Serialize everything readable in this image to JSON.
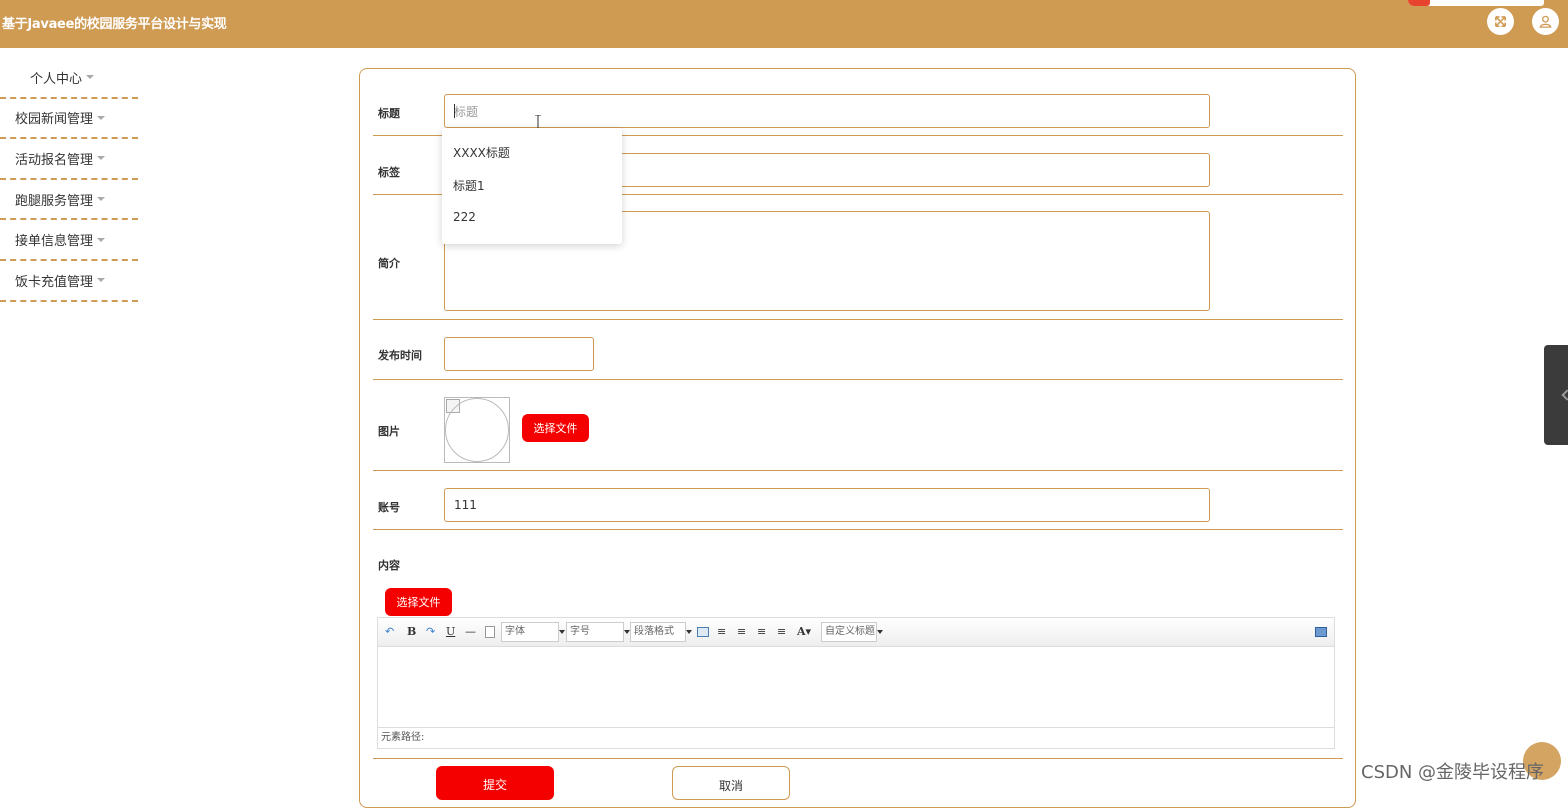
{
  "header": {
    "title": "基于Javaee的校园服务平台设计与实现",
    "accent_color": "#cf9a52",
    "icons": [
      "fullscreen-icon",
      "user-icon"
    ]
  },
  "sidebar": {
    "items": [
      {
        "label": "个人中心"
      },
      {
        "label": "校园新闻管理"
      },
      {
        "label": "活动报名管理"
      },
      {
        "label": "跑腿服务管理"
      },
      {
        "label": "接单信息管理"
      },
      {
        "label": "饭卡充值管理"
      }
    ]
  },
  "form": {
    "title_label": "标题",
    "title_placeholder": "标题",
    "title_suggestions": [
      "XXXX标题",
      "标题1",
      "222"
    ],
    "tag_label": "标签",
    "tag_value": "",
    "intro_label": "简介",
    "intro_value": "",
    "publish_time_label": "发布时间",
    "publish_time_value": "",
    "image_label": "图片",
    "image_choose_label": "选择文件",
    "account_label": "账号",
    "account_value": "111",
    "content_label": "内容",
    "content_choose_label": "选择文件",
    "editor": {
      "font_select": "字体",
      "size_select": "字号",
      "paragraph_select": "段落格式",
      "custom_title_select": "自定义标题",
      "path_label": "元素路径:",
      "tools": [
        "undo-icon",
        "bold-icon",
        "redo-icon",
        "underline-icon",
        "horizontal-rule-icon",
        "new-doc-icon",
        "table-icon",
        "align-left-icon",
        "align-right-icon",
        "align-center-icon",
        "justify-icon",
        "font-color-icon",
        "preview-icon"
      ]
    },
    "submit_label": "提交",
    "cancel_label": "取消"
  },
  "watermark": "CSDN @金陵毕设程序",
  "primary_button_color": "#f50000"
}
